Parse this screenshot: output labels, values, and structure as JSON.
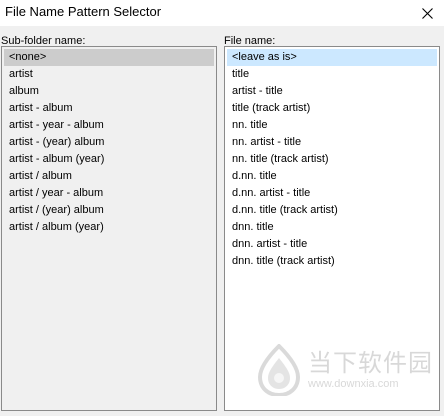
{
  "window": {
    "title": "File Name Pattern Selector",
    "close_glyph": "close-icon"
  },
  "subfolder": {
    "label": "Sub-folder name:",
    "items": [
      "<none>",
      "artist",
      "album",
      "artist - album",
      "artist - year - album",
      "artist - (year) album",
      "artist - album (year)",
      "artist / album",
      "artist / year - album",
      "artist / (year) album",
      "artist / album (year)"
    ],
    "selected_index": 0
  },
  "filename": {
    "label": "File name:",
    "items": [
      "<leave as is>",
      "title",
      "artist - title",
      "title (track artist)",
      "nn. title",
      "nn. artist - title",
      "nn. title (track artist)",
      "d.nn. title",
      "d.nn. artist - title",
      "d.nn. title (track artist)",
      "dnn. title",
      "dnn. artist - title",
      "dnn. title (track artist)"
    ],
    "selected_index": 0
  },
  "watermark": {
    "text_cn": "当下软件园",
    "url": "www.downxia.com"
  },
  "colors": {
    "selected_gray": "#cccccc",
    "selected_blue": "#cce8ff",
    "border": "#8a8a8a",
    "background": "#f0f0f0"
  }
}
